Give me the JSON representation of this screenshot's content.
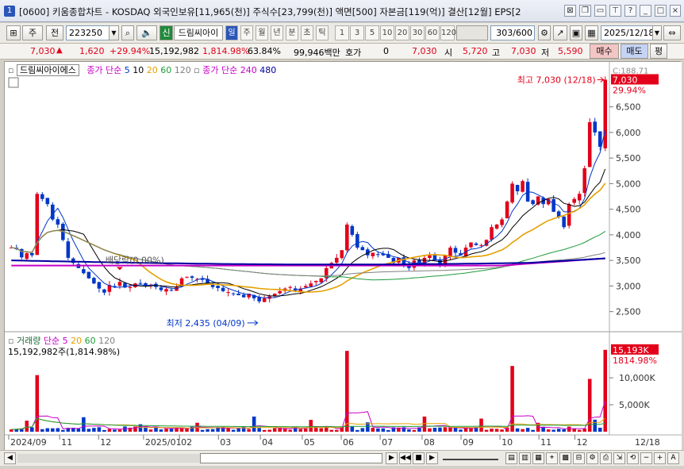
{
  "window": {
    "icon": "1",
    "title": "[0600] 키움종합차트 - KOSDAQ 외국인보유[11,965(천)] 주식수[23,799(천)] 액면[500] 자본금[119(억)] 결산[12월] EPS[2"
  },
  "toolbar": {
    "mode": "주",
    "all_label": "전",
    "code": "223250",
    "badge": "신",
    "stock_name": "드림씨아이",
    "periods": [
      "일",
      "주",
      "월",
      "년",
      "분",
      "초",
      "틱"
    ],
    "selected_period": "일",
    "ticks": [
      "1",
      "3",
      "5",
      "10",
      "20",
      "30",
      "60",
      "120"
    ],
    "count": "303/600",
    "date": "2025/12/18",
    "buy": "매수",
    "sell": "매도",
    "eval": "평"
  },
  "quote": {
    "price": "7,030",
    "change": "1,620",
    "change_pct": "+29.94%",
    "volume": "15,192,982",
    "volume_pct": "1,814.98%",
    "rotation": "63.84%",
    "amount": "99,946백만",
    "hoga_label": "호가",
    "hoga_val": "0",
    "hoga_price": "7,030",
    "open_label": "시",
    "open": "5,720",
    "high_label": "고",
    "high": "7,030",
    "low_label": "저",
    "low": "5,590"
  },
  "legend": {
    "price_name": "드림씨아이에스",
    "ma_label": "종가 단순",
    "ma_periods": [
      "5",
      "10",
      "20",
      "60",
      "120"
    ],
    "ma2_label": "종가 단순",
    "ma2_periods": [
      "240",
      "480"
    ],
    "vol_label": "거래량",
    "vol_ma_label": "단순",
    "vol_ma_periods": [
      "5",
      "20",
      "60",
      "120"
    ],
    "vol_value": "15,192,982주(1,814.98%)"
  },
  "annotations": {
    "high": "최고 7,030 (12/18)",
    "low": "최저 2,435 (04/09)",
    "dividend": "배당락(0.00%)"
  },
  "price_tags": {
    "change_pct": "C:188.71",
    "last": "7,030",
    "pct": "29.94%",
    "vol_last": "15,193K",
    "vol_pct": "1814.98%"
  },
  "colors": {
    "up": "#e2001a",
    "down": "#0037c8",
    "ma5": "#0037c8",
    "ma10": "#000000",
    "ma20": "#e6a000",
    "ma60": "#1f9b3a",
    "ma120": "#808080",
    "ma240": "#c800c8",
    "ma480": "#0000a0"
  },
  "chart_data": {
    "type": "candlestick",
    "y_ticks": [
      "6,500",
      "6,000",
      "5,500",
      "5,000",
      "4,500",
      "4,000",
      "3,500",
      "3,000",
      "2,500"
    ],
    "vol_ticks": [
      "10,000K",
      "5,000K"
    ],
    "x_ticks": [
      "2024/09",
      "11",
      "12",
      "2025/01",
      "02",
      "03",
      "04",
      "05",
      "06",
      "07",
      "08",
      "09",
      "10",
      "11",
      "12",
      "12/18"
    ],
    "price_range": [
      2200,
      7130
    ],
    "vol_range": [
      0,
      16200000
    ],
    "price_closes": [
      3750,
      3720,
      3560,
      3640,
      3600,
      4800,
      4700,
      4600,
      4300,
      4200,
      3900,
      3550,
      3450,
      3350,
      3250,
      3150,
      3050,
      2950,
      2870,
      3020,
      2980,
      3080,
      2970,
      2980,
      3050,
      3050,
      3000,
      3020,
      2980,
      2920,
      2940,
      2920,
      2980,
      3150,
      3180,
      3160,
      3140,
      3120,
      3050,
      2980,
      2960,
      2900,
      2880,
      2850,
      2820,
      2780,
      2850,
      2760,
      2700,
      2760,
      2800,
      2850,
      2900,
      2950,
      2980,
      2920,
      2950,
      3000,
      3050,
      3100,
      3150,
      3350,
      3450,
      3550,
      3700,
      4200,
      4000,
      3750,
      3700,
      3600,
      3650,
      3620,
      3600,
      3550,
      3450,
      3550,
      3400,
      3350,
      3500,
      3450,
      3550,
      3600,
      3500,
      3400,
      3600,
      3750,
      3650,
      3600,
      3750,
      3850,
      3800,
      3800,
      3900,
      4150,
      4200,
      4300,
      4650,
      5000,
      4850,
      5050,
      4650,
      4600,
      4750,
      4600,
      4700,
      4450,
      4350,
      4150,
      4600,
      4700,
      4800,
      5300,
      6200,
      6000,
      5720,
      7030
    ]
  }
}
